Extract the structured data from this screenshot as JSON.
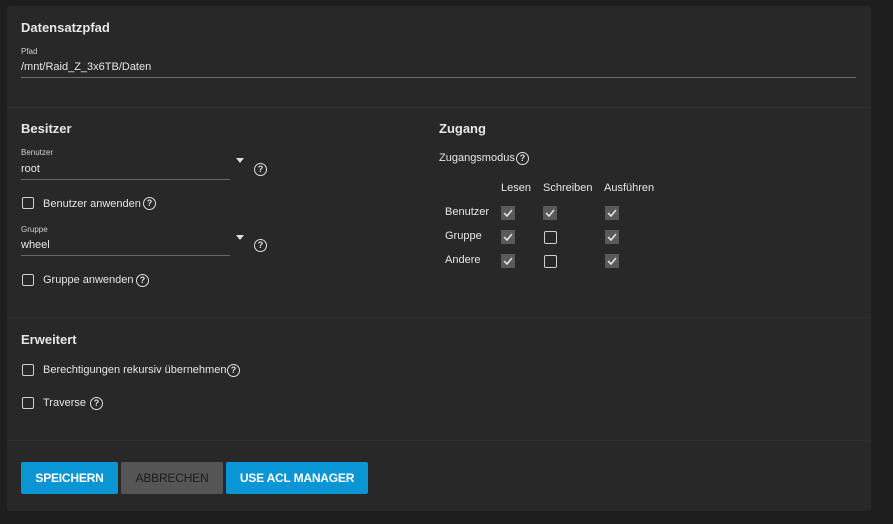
{
  "dataset": {
    "title": "Datensatzpfad",
    "path_label": "Pfad",
    "path_value": "/mnt/Raid_Z_3x6TB/Daten"
  },
  "owner": {
    "title": "Besitzer",
    "user_label": "Benutzer",
    "user_value": "root",
    "apply_user_label": "Benutzer anwenden",
    "group_label": "Gruppe",
    "group_value": "wheel",
    "apply_group_label": "Gruppe anwenden"
  },
  "access": {
    "title": "Zugang",
    "mode_label": "Zugangsmodus",
    "columns": [
      "Lesen",
      "Schreiben",
      "Ausführen"
    ],
    "rows": [
      {
        "label": "Benutzer",
        "read": true,
        "write": true,
        "execute": true
      },
      {
        "label": "Gruppe",
        "read": true,
        "write": false,
        "execute": true
      },
      {
        "label": "Andere",
        "read": true,
        "write": false,
        "execute": true
      }
    ]
  },
  "advanced": {
    "title": "Erweitert",
    "recursive_label": "Berechtigungen rekursiv übernehmen",
    "traverse_label": "Traverse"
  },
  "buttons": {
    "save": "SPEICHERN",
    "cancel": "ABBRECHEN",
    "acl": "USE ACL MANAGER"
  },
  "colors": {
    "accent": "#0a95d4",
    "card_bg": "#282828",
    "page_bg": "#1e1e1e"
  }
}
